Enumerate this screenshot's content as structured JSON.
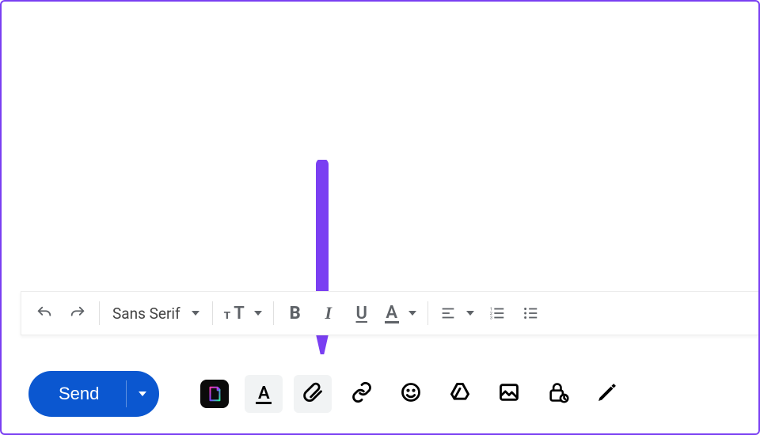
{
  "annotation": {
    "target": "attach-files-button"
  },
  "format_toolbar": {
    "undo": "Undo",
    "redo": "Redo",
    "font": {
      "label": "Sans Serif"
    },
    "font_size_label": "T",
    "bold_label": "B",
    "italic_label": "I",
    "underline_label": "U",
    "text_color_label": "A"
  },
  "actions": {
    "send_label": "Send",
    "send_more_aria": "More send options",
    "format_toggle_label": "A",
    "attach_aria": "Attach files",
    "link_aria": "Insert link",
    "emoji_aria": "Insert emoji",
    "drive_aria": "Insert files using Drive",
    "photo_aria": "Insert photo",
    "confidential_aria": "Toggle confidential mode",
    "signature_aria": "Insert signature"
  }
}
